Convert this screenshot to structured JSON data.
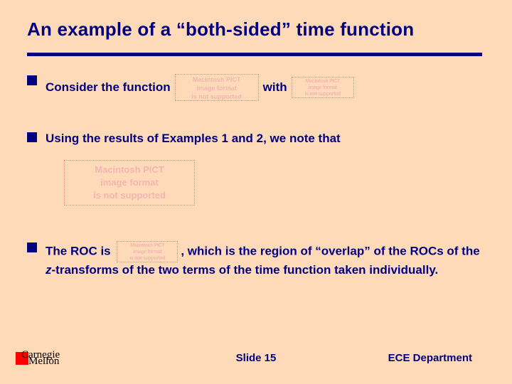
{
  "title": "An example of a “both-sided” time function",
  "bullets": {
    "b1": {
      "pre": "Consider the function",
      "mid": "with"
    },
    "b2": {
      "text": "Using the results of Examples 1 and 2, we note that"
    },
    "b3": {
      "pre": "The ROC is ",
      "post_a": ", which is the region of “overlap” of the ROCs of the ",
      "italic": "z",
      "post_b": "-transforms of the two terms of the time function taken individually."
    }
  },
  "pict_placeholder": "Macintosh PICT\nimage format\nis not supported",
  "footer": {
    "logo_line1": "Carnegie",
    "logo_line2": "Mellon",
    "slide_label": "Slide 15",
    "department": "ECE Department"
  }
}
